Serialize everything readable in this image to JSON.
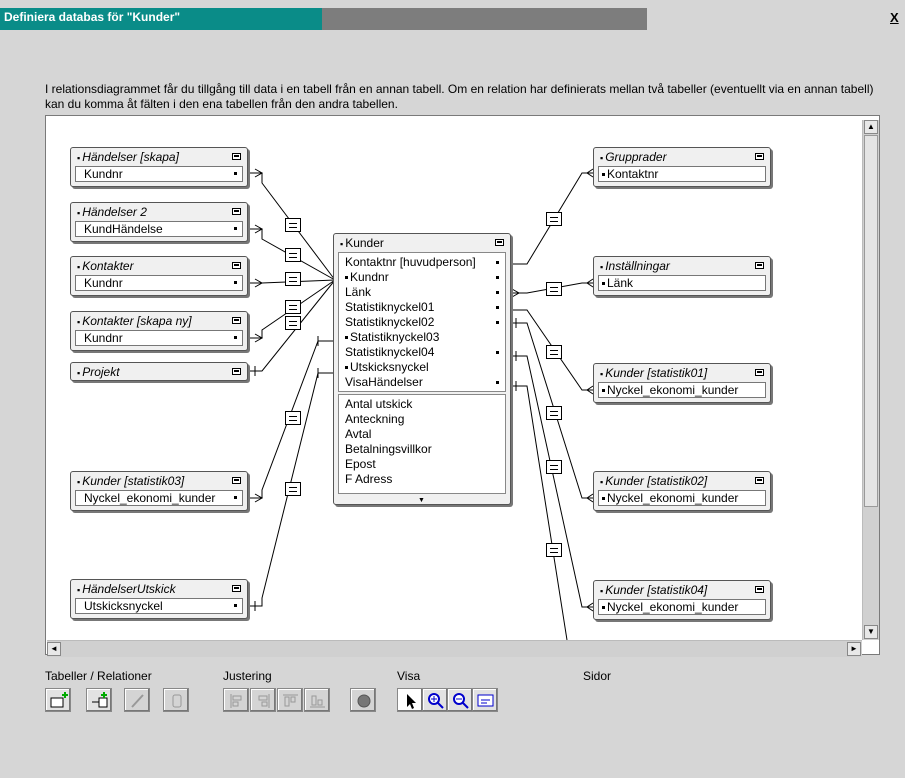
{
  "window": {
    "title_prefix": "Definiera databas för ",
    "title_name": "\"Kunder\"",
    "close": "X"
  },
  "description": "I relationsdiagrammet får du tillgång till data i en tabell från en annan tabell. Om en relation har definierats mellan två tabeller (eventuellt via en annan tabell) kan du komma åt fälten i den ena tabellen från den andra tabellen.",
  "tables": {
    "handelser_skapa": {
      "name": "Händelser [skapa]",
      "field": "Kundnr"
    },
    "handelser2": {
      "name": "Händelser 2",
      "field": "KundHändelse"
    },
    "kontakter": {
      "name": "Kontakter",
      "field": "Kundnr"
    },
    "kontakter_skapa_ny": {
      "name": "Kontakter [skapa ny]",
      "field": "Kundnr"
    },
    "projekt": {
      "name": "Projekt"
    },
    "kunder_statistik03": {
      "name": "Kunder [statistik03]",
      "field": "Nyckel_ekonomi_kunder"
    },
    "handelser_utskick": {
      "name": "HändelserUtskick",
      "field": "Utskicksnyckel"
    },
    "grupprader": {
      "name": "Grupprader",
      "field": "Kontaktnr"
    },
    "installningar": {
      "name": "Inställningar",
      "field": "Länk"
    },
    "kunder_statistik01": {
      "name": "Kunder [statistik01]",
      "field": "Nyckel_ekonomi_kunder"
    },
    "kunder_statistik02": {
      "name": "Kunder [statistik02]",
      "field": "Nyckel_ekonomi_kunder"
    },
    "kunder_statistik04": {
      "name": "Kunder [statistik04]",
      "field": "Nyckel_ekonomi_kunder"
    }
  },
  "kunder": {
    "name": "Kunder",
    "key_fields": [
      "Kontaktnr [huvudperson]",
      "Kundnr",
      "Länk",
      "Statistiknyckel01",
      "Statistiknyckel02",
      "Statistiknyckel03",
      "Statistiknyckel04",
      "Utskicksnyckel",
      "VisaHändelser"
    ],
    "other_fields": [
      "Antal utskick",
      "Anteckning",
      "Avtal",
      "Betalningsvillkor",
      "Epost",
      "F Adress"
    ]
  },
  "toolbar": {
    "group_tables": "Tabeller / Relationer",
    "group_align": "Justering",
    "group_view": "Visa",
    "group_pages": "Sidor"
  },
  "colors": {
    "title_active": "#0a8c88",
    "title_inactive": "#7d7d7d",
    "background": "#d6d6d6"
  }
}
